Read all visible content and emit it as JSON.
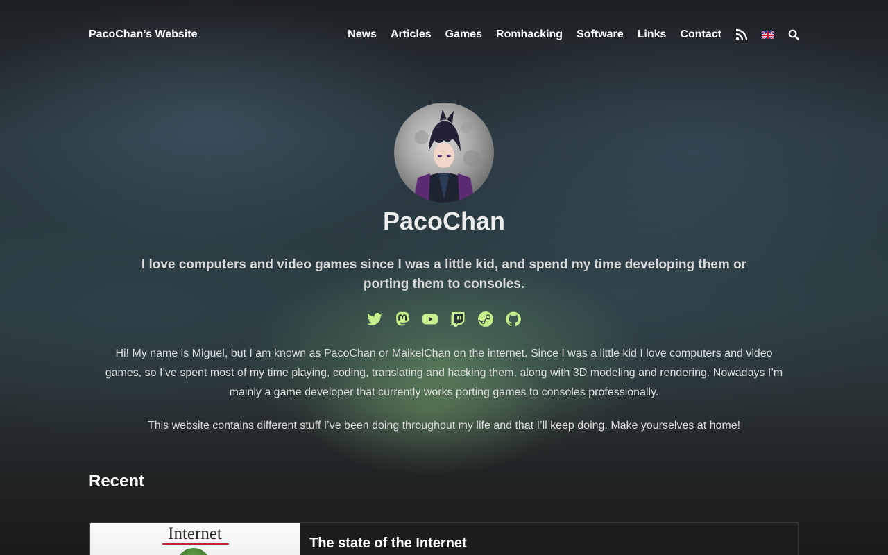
{
  "header": {
    "site_title": "PacoChan’s Website",
    "nav": [
      "News",
      "Articles",
      "Games",
      "Romhacking",
      "Software",
      "Links",
      "Contact"
    ],
    "icons": [
      "rss-icon",
      "uk-flag-icon",
      "search-icon"
    ]
  },
  "profile": {
    "name": "PacoChan",
    "tagline": "I love computers and video games since I was a little kid, and spend my time developing them or porting them to consoles.",
    "social_icons": [
      "twitter-icon",
      "mastodon-icon",
      "youtube-icon",
      "twitch-icon",
      "steam-icon",
      "github-icon"
    ],
    "accent_color": "#c6f08a",
    "bio_1": "Hi! My name is Miguel, but I am known as PacoChan or MaikelChan on the internet. Since I was a little kid I love computers and video games, so I’ve spent most of my time playing, coding, translating and hacking them, along with 3D modeling and rendering. Nowadays I’m mainly a game developer that currently works porting games to consoles professionally.",
    "bio_2": "This website contains different stuff I’ve been doing throughout my life and that I’ll keep doing. Make yourselves at home!"
  },
  "recent": {
    "heading": "Recent",
    "items": [
      {
        "thumb_text": "Internet",
        "title": "The state of the Internet"
      }
    ]
  }
}
